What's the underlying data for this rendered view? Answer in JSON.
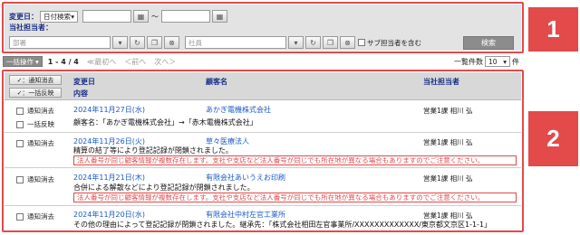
{
  "search": {
    "change_date_label": "変更日：",
    "date_mode": "日付検索",
    "range_sep": "〜",
    "staff_label": "当社担当者：",
    "dept_placeholder": "部署",
    "employee_placeholder": "社員",
    "sub_staff_label": "サブ担当者を含む",
    "search_button": "検索"
  },
  "badges": {
    "b1": "1",
    "b2": "2"
  },
  "toolbar": {
    "bulk_button": "一括操作",
    "count": "1 - 4 / 4",
    "first": "≪最初へ",
    "prev": "＜前へ",
    "next": "次へ＞",
    "per_page_label": "一覧件数",
    "per_page_value": "10",
    "per_page_unit": "件"
  },
  "table": {
    "bulk_clear_notice": "✓：通知消去",
    "bulk_revert": "✓：一括反映",
    "col_change_date": "変更日",
    "col_content": "内容",
    "col_customer": "顧客名",
    "col_staff": "当社担当者",
    "rows": [
      {
        "clear_label": "通知消去",
        "revert_label": "一括反映",
        "date": "2024年11月27日(水)",
        "customer": "あかぎ電機株式会社",
        "staff": "営業1課 相川 弘",
        "content": "顧客名：「あかぎ電機株式会社」→「赤木電機株式会社」",
        "warning": ""
      },
      {
        "clear_label": "通知消去",
        "date": "2024年11月26日(火)",
        "customer": "草々医療法人",
        "staff": "営業1課 相川 弘",
        "content": "精算の結了等により登記記録が閉鎖されました。",
        "warning": "法人番号が同じ顧客情報が複数存在します。支社や支店など法人番号が同じでも所在地が異なる場合もありますのでご注意ください。"
      },
      {
        "clear_label": "通知消去",
        "date": "2024年11月21日(木)",
        "customer": "有限会社あいうえお印刷",
        "staff": "営業1課 相川 弘",
        "content": "合併による解散などにより登記記録が閉鎖されました。",
        "warning": "法人番号が同じ顧客情報が複数存在します。支社や支店など法人番号が同じでも所在地が異なる場合もありますのでご注意ください。"
      },
      {
        "clear_label": "通知消去",
        "date": "2024年11月20日(水)",
        "customer": "有限会社中村左官工業所",
        "staff": "営業1課 相川 弘",
        "content": "その他の理由によって登記記録が閉鎖されました。継承先：「株式会社相田左官事業所/XXXXXXXXXXXXX/東京都文京区1-1-1」",
        "warning": ""
      }
    ]
  }
}
